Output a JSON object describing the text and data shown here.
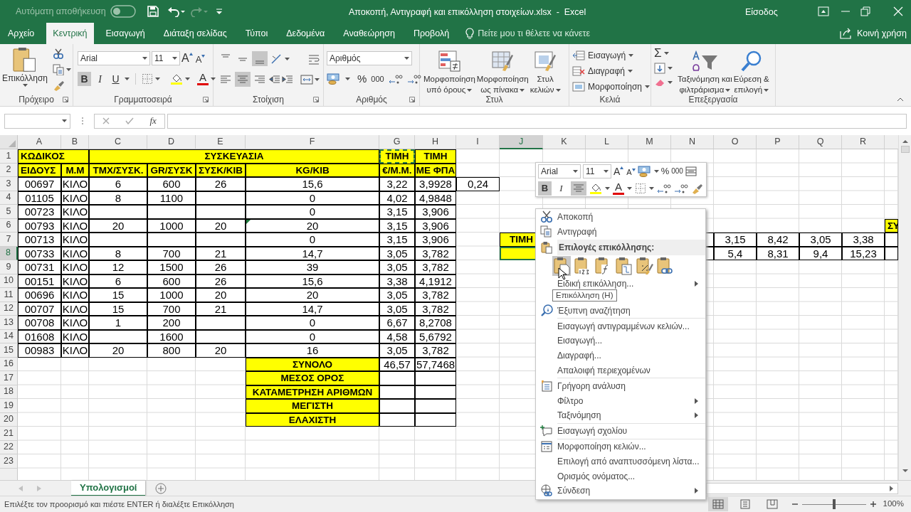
{
  "title_bar": {
    "autosave_label": "Αυτόματη αποθήκευση",
    "autosave_on": false,
    "title": "Αποκοπή, Αντιγραφή και επικόλληση στοιχείων.xlsx  -  Excel",
    "sign_in": "Είσοδος"
  },
  "tabs": [
    {
      "label": "Αρχείο",
      "selected": false
    },
    {
      "label": "Κεντρική",
      "selected": true
    },
    {
      "label": "Εισαγωγή",
      "selected": false
    },
    {
      "label": "Διάταξη σελίδας",
      "selected": false
    },
    {
      "label": "Τύποι",
      "selected": false
    },
    {
      "label": "Δεδομένα",
      "selected": false
    },
    {
      "label": "Αναθεώρηση",
      "selected": false
    },
    {
      "label": "Προβολή",
      "selected": false
    }
  ],
  "tell_me": "Πείτε μου τι θέλετε να κάνετε",
  "share": "Κοινή χρήση",
  "ribbon": [
    {
      "kind": "clipboard",
      "label": "Πρόχειρο",
      "paste": "Επικόλληση"
    },
    {
      "kind": "font",
      "label": "Γραμματοσειρά",
      "font": "Arial",
      "size": "11",
      "grow": "A",
      "shrink": "A",
      "font_color_glyph": "A",
      "buttons": [
        {
          "label": "B",
          "selected": true
        },
        {
          "label": "I",
          "selected": false
        },
        {
          "label": "U",
          "selected": false
        }
      ]
    },
    {
      "kind": "alignment",
      "label": "Στοίχιση",
      "vertical_options": [
        {
          "selected": false
        },
        {
          "selected": false
        },
        {
          "selected": true
        }
      ],
      "horizontal_options": [
        {
          "selected": false
        },
        {
          "selected": true
        },
        {
          "selected": false
        }
      ]
    },
    {
      "kind": "number",
      "label": "Αριθμός",
      "format": "Αριθμός",
      "percent": "%",
      "thousands": "000"
    },
    {
      "kind": "styles",
      "label": "Στυλ",
      "buttons": [
        {
          "lines": [
            "Μορφοποίηση",
            "υπό όρους"
          ]
        },
        {
          "lines": [
            "Μορφοποίηση",
            "ως πίνακα"
          ]
        },
        {
          "lines": [
            "Στυλ",
            "κελιών"
          ]
        }
      ]
    },
    {
      "kind": "cells",
      "label": "Κελιά",
      "buttons": [
        "Εισαγωγή",
        "Διαγραφή",
        "Μορφοποίηση"
      ]
    },
    {
      "kind": "editing",
      "label": "Επεξεργασία",
      "sum": "Σ",
      "buttons": [
        {
          "lines": [
            "Ταξινόμηση και",
            "φιλτράρισμα"
          ]
        },
        {
          "lines": [
            "Εύρεση &",
            "επιλογή"
          ]
        }
      ]
    }
  ],
  "formula_bar": {
    "function_label": "fx"
  },
  "sheet": {
    "columns": [
      {
        "label": "A",
        "selected": false
      },
      {
        "label": "B",
        "selected": false
      },
      {
        "label": "C",
        "selected": false
      },
      {
        "label": "D",
        "selected": false
      },
      {
        "label": "E",
        "selected": false
      },
      {
        "label": "F",
        "selected": false
      },
      {
        "label": "G",
        "selected": false
      },
      {
        "label": "H",
        "selected": false
      },
      {
        "label": "I",
        "selected": false
      },
      {
        "label": "J",
        "selected": true
      },
      {
        "label": "K",
        "selected": false
      },
      {
        "label": "L",
        "selected": false
      },
      {
        "label": "M",
        "selected": false
      },
      {
        "label": "N",
        "selected": false
      },
      {
        "label": "O",
        "selected": false
      },
      {
        "label": "P",
        "selected": false
      },
      {
        "label": "Q",
        "selected": false
      },
      {
        "label": "R",
        "selected": false
      }
    ],
    "rows": [
      {
        "number": "1",
        "selected": false,
        "cells": [
          {
            "kind": "label_left",
            "text": "ΚΩΔΙΚΟΣ"
          },
          {
            "kind": "merged"
          },
          {
            "kind": "label",
            "text": "ΣΥΣΚΕΥΑΣΙΑ"
          },
          {
            "kind": "merged"
          },
          {
            "kind": "merged"
          },
          {
            "kind": "merged"
          },
          {
            "kind": "label",
            "text": "ΤΙΜΗ",
            "copied": true
          },
          {
            "kind": "label",
            "text": "ΤΙΜΗ"
          }
        ]
      },
      {
        "number": "2",
        "selected": false,
        "cells": [
          {
            "kind": "label_left",
            "text": "ΕΙΔΟΥΣ"
          },
          {
            "kind": "label",
            "text": "Μ.Μ"
          },
          {
            "kind": "label",
            "text": "ΤΜΧ/ΣΥΣΚ."
          },
          {
            "kind": "label",
            "text": "GR/ΣΥΣΚ"
          },
          {
            "kind": "label",
            "text": "ΣΥΣΚ/ΚΙΒ"
          },
          {
            "kind": "label",
            "text": "KG/KIB"
          },
          {
            "kind": "label",
            "text": "€/Μ.Μ."
          },
          {
            "kind": "label",
            "text": "ΜΕ ΦΠΑ"
          }
        ]
      },
      {
        "number": "3",
        "selected": false,
        "cells": [
          {
            "kind": "data",
            "text": "00697"
          },
          {
            "kind": "data",
            "text": "ΚΙΛΟ"
          },
          {
            "kind": "data",
            "text": "6"
          },
          {
            "kind": "data",
            "text": "600"
          },
          {
            "kind": "data",
            "text": "26"
          },
          {
            "kind": "data",
            "text": "15,6"
          },
          {
            "kind": "data",
            "text": "3,22"
          },
          {
            "kind": "data",
            "text": "3,9928"
          },
          {
            "kind": "data",
            "text": "0,24"
          }
        ]
      },
      {
        "number": "4",
        "selected": false,
        "cells": [
          {
            "kind": "data",
            "text": "01105"
          },
          {
            "kind": "data",
            "text": "ΚΙΛΟ"
          },
          {
            "kind": "data",
            "text": "8"
          },
          {
            "kind": "data",
            "text": "1100"
          },
          {
            "kind": "data"
          },
          {
            "kind": "data",
            "text": "0"
          },
          {
            "kind": "data",
            "text": "4,02"
          },
          {
            "kind": "data",
            "text": "4,9848"
          }
        ]
      },
      {
        "number": "5",
        "selected": false,
        "cells": [
          {
            "kind": "data",
            "text": "00723"
          },
          {
            "kind": "data",
            "text": "ΚΙΛΟ"
          },
          {
            "kind": "data"
          },
          {
            "kind": "data"
          },
          {
            "kind": "data"
          },
          {
            "kind": "data",
            "text": "0"
          },
          {
            "kind": "data",
            "text": "3,15"
          },
          {
            "kind": "data",
            "text": "3,906"
          }
        ]
      },
      {
        "number": "6",
        "selected": false,
        "cells": [
          {
            "kind": "data",
            "text": "00793"
          },
          {
            "kind": "data",
            "text": "ΚΙΛΟ"
          },
          {
            "kind": "data",
            "text": "20"
          },
          {
            "kind": "data",
            "text": "1000"
          },
          {
            "kind": "data",
            "text": "20"
          },
          {
            "kind": "data",
            "text": "20",
            "error_flag": true
          },
          {
            "kind": "data",
            "text": "3,15"
          },
          {
            "kind": "data",
            "text": "3,906"
          },
          {
            "kind": "blank"
          },
          {
            "kind": "blank"
          },
          {
            "kind": "blank"
          },
          {
            "kind": "blank"
          },
          {
            "kind": "blank"
          },
          {
            "kind": "blank"
          },
          {
            "kind": "blank"
          },
          {
            "kind": "blank"
          },
          {
            "kind": "blank"
          },
          {
            "kind": "blank"
          },
          {
            "kind": "label_left",
            "text": "ΣΥ"
          }
        ]
      },
      {
        "number": "7",
        "selected": false,
        "cells": [
          {
            "kind": "data",
            "text": "00713"
          },
          {
            "kind": "data",
            "text": "ΚΙΛΟ"
          },
          {
            "kind": "data"
          },
          {
            "kind": "data"
          },
          {
            "kind": "data"
          },
          {
            "kind": "data",
            "text": "0"
          },
          {
            "kind": "data",
            "text": "3,15"
          },
          {
            "kind": "data",
            "text": "3,906"
          },
          {
            "kind": "blank"
          },
          {
            "kind": "label",
            "text": "ΤΙΜΗ"
          },
          {
            "kind": "blank"
          },
          {
            "kind": "blank"
          },
          {
            "kind": "blank"
          },
          {
            "kind": "data"
          },
          {
            "kind": "data",
            "text": "3,15"
          },
          {
            "kind": "data",
            "text": "8,42"
          },
          {
            "kind": "data",
            "text": "3,05"
          },
          {
            "kind": "data",
            "text": "3,38"
          },
          {
            "kind": "data"
          }
        ]
      },
      {
        "number": "8",
        "selected": true,
        "cells": [
          {
            "kind": "data",
            "text": "00733"
          },
          {
            "kind": "data",
            "text": "ΚΙΛΟ"
          },
          {
            "kind": "data",
            "text": "8"
          },
          {
            "kind": "data",
            "text": "700"
          },
          {
            "kind": "data",
            "text": "21"
          },
          {
            "kind": "data",
            "text": "14,7"
          },
          {
            "kind": "data",
            "text": "3,05"
          },
          {
            "kind": "data",
            "text": "3,782"
          },
          {
            "kind": "blank"
          },
          {
            "kind": "label",
            "selected": true
          },
          {
            "kind": "blank"
          },
          {
            "kind": "blank"
          },
          {
            "kind": "blank"
          },
          {
            "kind": "data"
          },
          {
            "kind": "data",
            "text": "5,4"
          },
          {
            "kind": "data",
            "text": "8,31"
          },
          {
            "kind": "data",
            "text": "9,4"
          },
          {
            "kind": "data",
            "text": "15,23"
          },
          {
            "kind": "data"
          }
        ]
      },
      {
        "number": "9",
        "selected": false,
        "cells": [
          {
            "kind": "data",
            "text": "00731"
          },
          {
            "kind": "data",
            "text": "ΚΙΛΟ"
          },
          {
            "kind": "data",
            "text": "12"
          },
          {
            "kind": "data",
            "text": "1500"
          },
          {
            "kind": "data",
            "text": "26"
          },
          {
            "kind": "data",
            "text": "39"
          },
          {
            "kind": "data",
            "text": "3,05"
          },
          {
            "kind": "data",
            "text": "3,782"
          }
        ]
      },
      {
        "number": "10",
        "selected": false,
        "cells": [
          {
            "kind": "data",
            "text": "00151"
          },
          {
            "kind": "data",
            "text": "ΚΙΛΟ"
          },
          {
            "kind": "data",
            "text": "6"
          },
          {
            "kind": "data",
            "text": "600"
          },
          {
            "kind": "data",
            "text": "26"
          },
          {
            "kind": "data",
            "text": "15,6"
          },
          {
            "kind": "data",
            "text": "3,38"
          },
          {
            "kind": "data",
            "text": "4,1912"
          }
        ]
      },
      {
        "number": "11",
        "selected": false,
        "cells": [
          {
            "kind": "data",
            "text": "00696"
          },
          {
            "kind": "data",
            "text": "ΚΙΛΟ"
          },
          {
            "kind": "data",
            "text": "15"
          },
          {
            "kind": "data",
            "text": "1000"
          },
          {
            "kind": "data",
            "text": "20"
          },
          {
            "kind": "data",
            "text": "20"
          },
          {
            "kind": "data",
            "text": "3,05"
          },
          {
            "kind": "data",
            "text": "3,782"
          }
        ]
      },
      {
        "number": "12",
        "selected": false,
        "cells": [
          {
            "kind": "data",
            "text": "00707"
          },
          {
            "kind": "data",
            "text": "ΚΙΛΟ"
          },
          {
            "kind": "data",
            "text": "15"
          },
          {
            "kind": "data",
            "text": "700"
          },
          {
            "kind": "data",
            "text": "21"
          },
          {
            "kind": "data",
            "text": "14,7"
          },
          {
            "kind": "data",
            "text": "3,05"
          },
          {
            "kind": "data",
            "text": "3,782"
          }
        ]
      },
      {
        "number": "13",
        "selected": false,
        "cells": [
          {
            "kind": "data",
            "text": "00708"
          },
          {
            "kind": "data",
            "text": "ΚΙΛΟ"
          },
          {
            "kind": "data",
            "text": "1"
          },
          {
            "kind": "data",
            "text": "200"
          },
          {
            "kind": "data"
          },
          {
            "kind": "data",
            "text": "0"
          },
          {
            "kind": "data",
            "text": "6,67"
          },
          {
            "kind": "data",
            "text": "8,2708"
          }
        ]
      },
      {
        "number": "14",
        "selected": false,
        "cells": [
          {
            "kind": "data",
            "text": "01608"
          },
          {
            "kind": "data",
            "text": "ΚΙΛΟ"
          },
          {
            "kind": "data"
          },
          {
            "kind": "data",
            "text": "1600"
          },
          {
            "kind": "data"
          },
          {
            "kind": "data",
            "text": "0"
          },
          {
            "kind": "data",
            "text": "4,58"
          },
          {
            "kind": "data",
            "text": "5,6792"
          }
        ]
      },
      {
        "number": "15",
        "selected": false,
        "cells": [
          {
            "kind": "data",
            "text": "00983"
          },
          {
            "kind": "data",
            "text": "ΚΙΛΟ"
          },
          {
            "kind": "data",
            "text": "20"
          },
          {
            "kind": "data",
            "text": "800"
          },
          {
            "kind": "data",
            "text": "20"
          },
          {
            "kind": "data",
            "text": "16"
          },
          {
            "kind": "data",
            "text": "3,05"
          },
          {
            "kind": "data",
            "text": "3,782"
          }
        ]
      },
      {
        "number": "16",
        "selected": false,
        "cells": [
          {
            "kind": "blank"
          },
          {
            "kind": "blank"
          },
          {
            "kind": "blank"
          },
          {
            "kind": "blank"
          },
          {
            "kind": "blank"
          },
          {
            "kind": "label",
            "text": "ΣΥΝΟΛΟ"
          },
          {
            "kind": "data",
            "text": "46,57"
          },
          {
            "kind": "data",
            "text": "57,7468"
          }
        ]
      },
      {
        "number": "17",
        "selected": false,
        "cells": [
          {
            "kind": "blank"
          },
          {
            "kind": "blank"
          },
          {
            "kind": "blank"
          },
          {
            "kind": "blank"
          },
          {
            "kind": "blank"
          },
          {
            "kind": "label",
            "text": "ΜΕΣΟΣ ΟΡΟΣ"
          },
          {
            "kind": "data"
          },
          {
            "kind": "data"
          }
        ]
      },
      {
        "number": "18",
        "selected": false,
        "cells": [
          {
            "kind": "blank"
          },
          {
            "kind": "blank"
          },
          {
            "kind": "blank"
          },
          {
            "kind": "blank"
          },
          {
            "kind": "blank"
          },
          {
            "kind": "label",
            "text": "ΚΑΤΑΜΕΤΡΗΣΗ ΑΡΙΘΜΩΝ"
          },
          {
            "kind": "data"
          },
          {
            "kind": "data"
          }
        ]
      },
      {
        "number": "19",
        "selected": false,
        "cells": [
          {
            "kind": "blank"
          },
          {
            "kind": "blank"
          },
          {
            "kind": "blank"
          },
          {
            "kind": "blank"
          },
          {
            "kind": "blank"
          },
          {
            "kind": "label",
            "text": "ΜΕΓΙΣΤΗ"
          },
          {
            "kind": "data"
          },
          {
            "kind": "data"
          }
        ]
      },
      {
        "number": "20",
        "selected": false,
        "cells": [
          {
            "kind": "blank"
          },
          {
            "kind": "blank"
          },
          {
            "kind": "blank"
          },
          {
            "kind": "blank"
          },
          {
            "kind": "blank"
          },
          {
            "kind": "label",
            "text": "ΕΛΑΧΙΣΤΗ"
          },
          {
            "kind": "data"
          },
          {
            "kind": "data"
          }
        ]
      },
      {
        "number": "21",
        "selected": false
      },
      {
        "number": "22",
        "selected": false
      },
      {
        "number": "23",
        "selected": false
      }
    ]
  },
  "mini_toolbar": {
    "font": "Arial",
    "size": "11",
    "grow": "A",
    "shrink": "A",
    "percent": "%",
    "thousands": "000",
    "font_color_glyph": "A",
    "buttons": [
      {
        "label": "B",
        "selected": true
      },
      {
        "label": "I",
        "selected": false
      }
    ],
    "center_selected": true
  },
  "context_menu": [
    {
      "kind": "command",
      "label": "Αποκοπή",
      "submenu": false
    },
    {
      "kind": "command",
      "label": "Αντιγραφή",
      "submenu": false
    },
    {
      "kind": "section",
      "label": "Επιλογές επικόλλησης:"
    },
    {
      "kind": "paste_options",
      "options": [
        {
          "selected": true
        },
        {
          "selected": false
        },
        {
          "selected": false
        },
        {
          "selected": false
        },
        {
          "selected": false
        },
        {
          "selected": false
        }
      ]
    },
    {
      "kind": "command",
      "label": "Ειδική επικόλληση...",
      "submenu": true
    },
    {
      "kind": "command",
      "label": "Έξυπνη αναζήτηση",
      "submenu": false
    },
    {
      "kind": "separator"
    },
    {
      "kind": "command",
      "label": "Εισαγωγή αντιγραμμένων κελιών...",
      "submenu": false
    },
    {
      "kind": "command",
      "label": "Εισαγωγή...",
      "submenu": false
    },
    {
      "kind": "command",
      "label": "Διαγραφή...",
      "submenu": false
    },
    {
      "kind": "command",
      "label": "Απαλοιφή περιεχομένων",
      "submenu": false
    },
    {
      "kind": "separator"
    },
    {
      "kind": "command",
      "label": "Γρήγορη ανάλυση",
      "submenu": false
    },
    {
      "kind": "command",
      "label": "Φίλτρο",
      "submenu": true
    },
    {
      "kind": "command",
      "label": "Ταξινόμηση",
      "submenu": true
    },
    {
      "kind": "separator"
    },
    {
      "kind": "command",
      "label": "Εισαγωγή σχολίου",
      "submenu": false
    },
    {
      "kind": "separator"
    },
    {
      "kind": "command",
      "label": "Μορφοποίηση κελιών...",
      "submenu": false
    },
    {
      "kind": "command",
      "label": "Επιλογή από αναπτυσσόμενη λίστα...",
      "submenu": false
    },
    {
      "kind": "command",
      "label": "Ορισμός ονόματος...",
      "submenu": false
    },
    {
      "kind": "command",
      "label": "Σύνδεση",
      "submenu": true
    }
  ],
  "tooltip": "Επικόλληση (Η)",
  "sheet_tabs": [
    {
      "label": "Υπολογισμοί",
      "selected": true
    }
  ],
  "status_bar": {
    "message": "Επιλέξτε τον προορισμό και πιέστε ENTER ή διαλέξτε Επικόλληση",
    "views": [
      {
        "selected": true
      },
      {
        "selected": false
      },
      {
        "selected": false
      }
    ],
    "zoom": {
      "level": 0.5,
      "reading": "100%"
    }
  }
}
